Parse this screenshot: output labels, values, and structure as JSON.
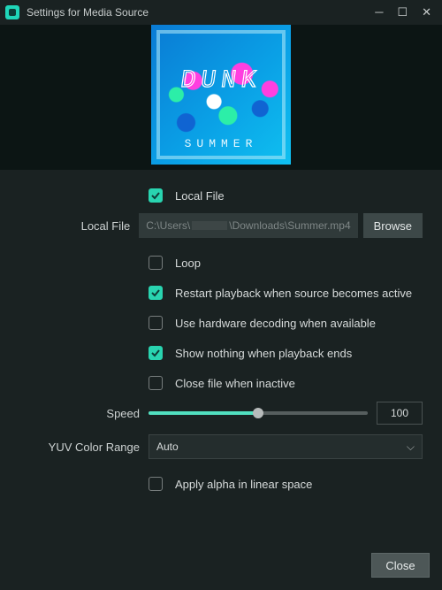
{
  "window": {
    "title": "Settings for Media Source"
  },
  "preview": {
    "artwork_word_top": "DUNK",
    "artwork_word_bottom": "SUMMER"
  },
  "form": {
    "local_file_checkbox": {
      "label": "Local File",
      "checked": true
    },
    "local_file_path": {
      "label": "Local File",
      "value_prefix": "C:\\Users\\",
      "value_suffix": "\\Downloads\\Summer.mp4",
      "browse": "Browse"
    },
    "loop": {
      "label": "Loop",
      "checked": false
    },
    "restart_active": {
      "label": "Restart playback when source becomes active",
      "checked": true
    },
    "hw_decode": {
      "label": "Use hardware decoding when available",
      "checked": false
    },
    "show_nothing_end": {
      "label": "Show nothing when playback ends",
      "checked": true
    },
    "close_inactive": {
      "label": "Close file when inactive",
      "checked": false
    },
    "speed": {
      "label": "Speed",
      "value": 100,
      "percent": 50
    },
    "yuv": {
      "label": "YUV Color Range",
      "value": "Auto"
    },
    "apply_alpha": {
      "label": "Apply alpha in linear space",
      "checked": false
    }
  },
  "footer": {
    "close": "Close"
  },
  "colors": {
    "accent": "#29d4b0",
    "bg": "#1a2222",
    "bg_dark": "#0c1514"
  }
}
